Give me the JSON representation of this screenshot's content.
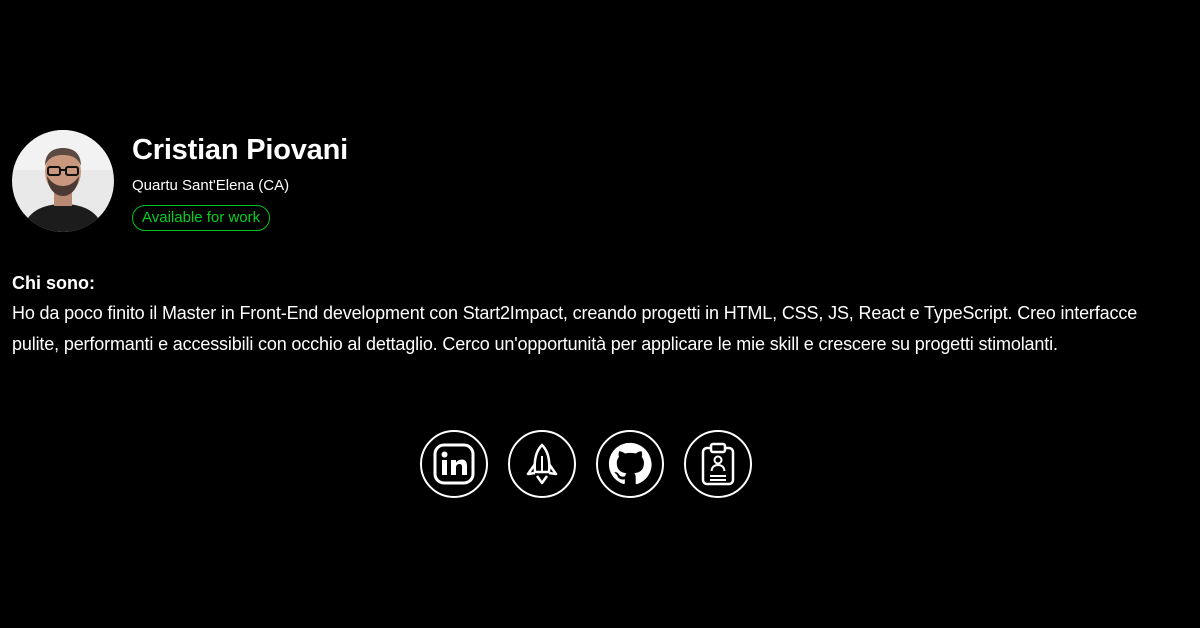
{
  "profile": {
    "name": "Cristian Piovani",
    "location": "Quartu Sant'Elena (CA)",
    "status": "Available for work"
  },
  "about": {
    "title": "Chi sono:",
    "text": "Ho da poco finito il Master in Front-End development con Start2Impact, creando progetti in HTML, CSS, JS, React e TypeScript. Creo interfacce pulite, performanti e accessibili con occhio al dettaglio. Cerco un'opportunità per applicare le mie skill e crescere su progetti stimolanti."
  },
  "social": [
    {
      "icon": "linkedin-icon"
    },
    {
      "icon": "rocket-icon"
    },
    {
      "icon": "github-icon"
    },
    {
      "icon": "resume-clipboard-icon"
    }
  ],
  "colors": {
    "background": "#000000",
    "text": "#ffffff",
    "status": "#00c21b"
  }
}
